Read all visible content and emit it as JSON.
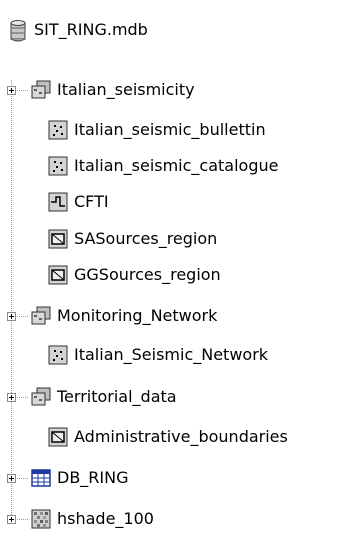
{
  "tree": {
    "root": {
      "label": "SIT_RING.mdb",
      "icon": "database-icon"
    },
    "items": [
      {
        "label": "Italian_seismicity",
        "icon": "feature-dataset-icon",
        "expandable": true
      },
      {
        "label": "Italian_seismic_bullettin",
        "icon": "point-feature-class-icon"
      },
      {
        "label": "Italian_seismic_catalogue",
        "icon": "point-feature-class-icon"
      },
      {
        "label": "CFTI",
        "icon": "line-feature-class-icon"
      },
      {
        "label": "SASources_region",
        "icon": "polygon-feature-class-icon"
      },
      {
        "label": "GGSources_region",
        "icon": "polygon-feature-class-icon"
      },
      {
        "label": "Monitoring_Network",
        "icon": "feature-dataset-icon",
        "expandable": true
      },
      {
        "label": "Italian_Seismic_Network",
        "icon": "point-feature-class-icon"
      },
      {
        "label": "Territorial_data",
        "icon": "feature-dataset-icon",
        "expandable": true
      },
      {
        "label": "Administrative_boundaries",
        "icon": "polygon-feature-class-icon"
      },
      {
        "label": "DB_RING",
        "icon": "table-icon",
        "expandable": true
      },
      {
        "label": "hshade_100",
        "icon": "raster-dataset-icon",
        "expandable": true
      }
    ]
  },
  "colors": {
    "icon_gray": "#c0c0c0",
    "table_blue": "#1e3a9c",
    "dot_gray": "#9a9a9a"
  }
}
